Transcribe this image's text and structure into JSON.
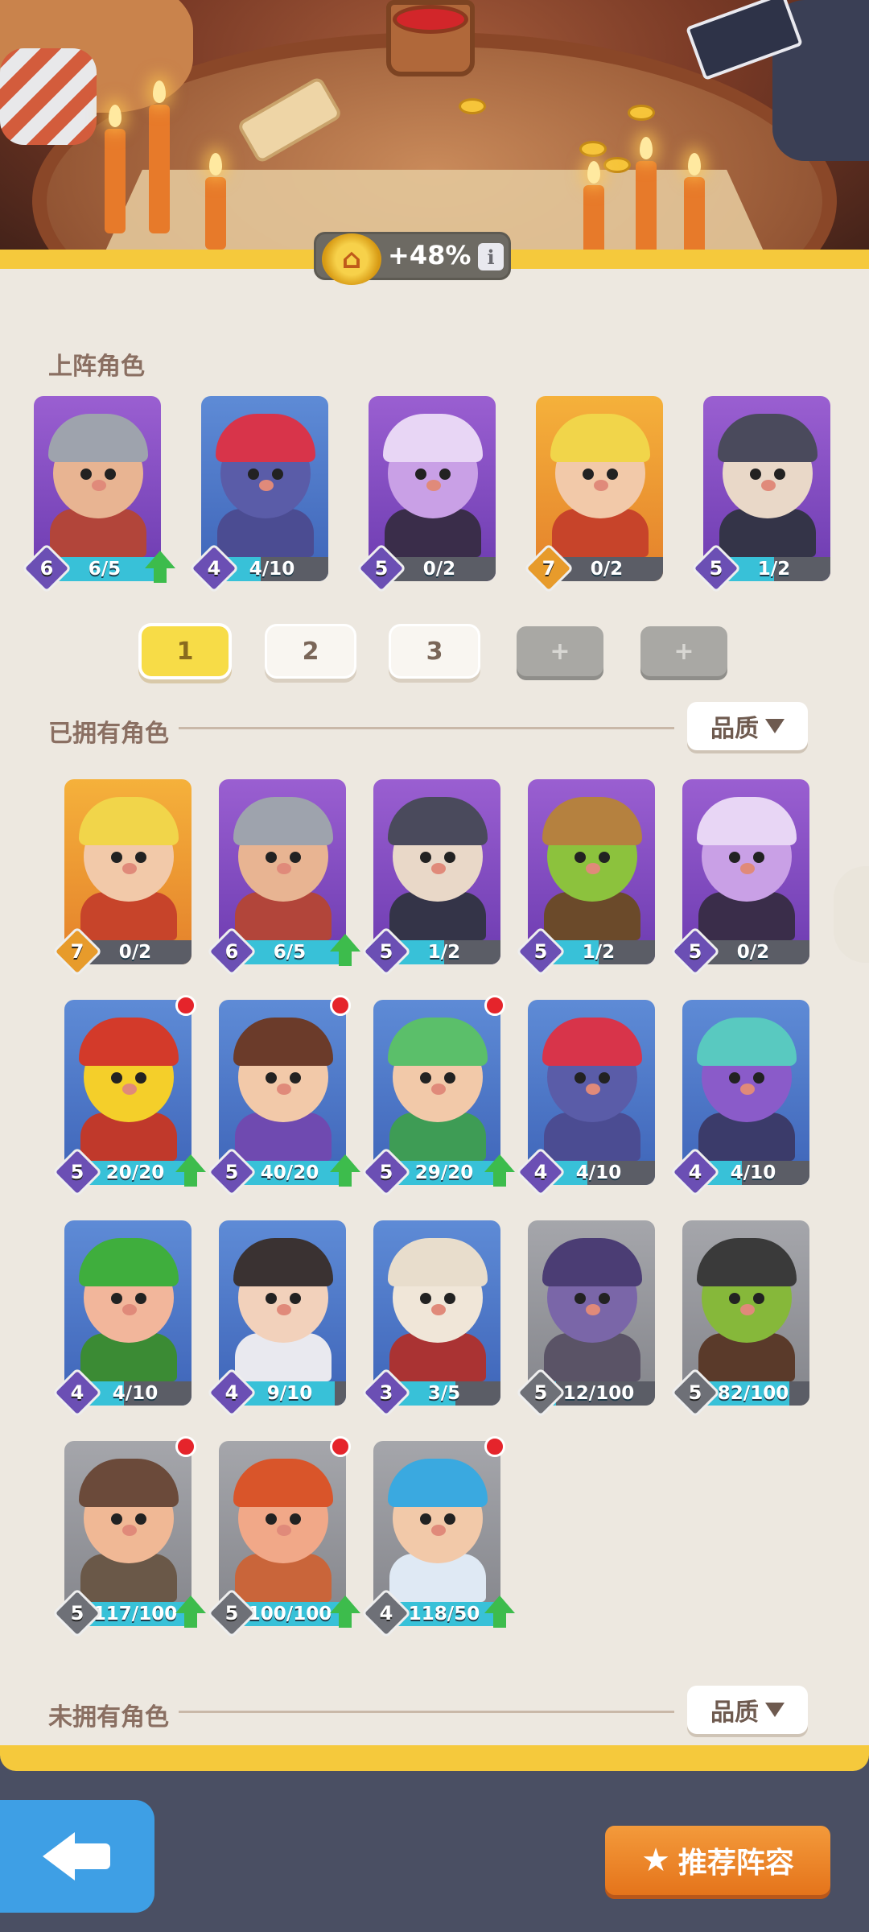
{
  "bonus": {
    "text": "+48%",
    "info_label": "i"
  },
  "sections": {
    "lineup_title": "上阵角色",
    "owned_title": "已拥有角色",
    "unowned_title": "未拥有角色"
  },
  "quality_button_label": "品质",
  "team_slots": [
    {
      "label": "1",
      "state": "active"
    },
    {
      "label": "2",
      "state": "normal"
    },
    {
      "label": "3",
      "state": "normal"
    },
    {
      "label": "+",
      "state": "locked"
    },
    {
      "label": "+",
      "state": "locked"
    }
  ],
  "lineup": [
    {
      "level": "6",
      "progress": "6/5",
      "ratio": 1.0,
      "rarity": "purple",
      "bg": "purple",
      "upgrade": true,
      "hero": "knight"
    },
    {
      "level": "4",
      "progress": "4/10",
      "ratio": 0.4,
      "rarity": "purple",
      "bg": "blue",
      "upgrade": false,
      "hero": "eye-mage"
    },
    {
      "level": "5",
      "progress": "0/2",
      "ratio": 0.0,
      "rarity": "purple",
      "bg": "purple",
      "upgrade": false,
      "hero": "demon-girl"
    },
    {
      "level": "7",
      "progress": "0/2",
      "ratio": 0.0,
      "rarity": "orange",
      "bg": "orange",
      "upgrade": false,
      "hero": "gunner"
    },
    {
      "level": "5",
      "progress": "1/2",
      "ratio": 0.5,
      "rarity": "purple",
      "bg": "purple",
      "upgrade": false,
      "hero": "dark-knight"
    }
  ],
  "owned": [
    {
      "level": "7",
      "progress": "0/2",
      "ratio": 0.0,
      "rarity": "orange",
      "bg": "orange",
      "upgrade": false,
      "dot": false,
      "hero": "gunner"
    },
    {
      "level": "6",
      "progress": "6/5",
      "ratio": 1.0,
      "rarity": "purple",
      "bg": "purple",
      "upgrade": true,
      "dot": false,
      "hero": "knight"
    },
    {
      "level": "5",
      "progress": "1/2",
      "ratio": 0.5,
      "rarity": "purple",
      "bg": "purple",
      "upgrade": false,
      "dot": false,
      "hero": "dark-knight"
    },
    {
      "level": "5",
      "progress": "1/2",
      "ratio": 0.5,
      "rarity": "purple",
      "bg": "purple",
      "upgrade": false,
      "dot": false,
      "hero": "goblin-engineer"
    },
    {
      "level": "5",
      "progress": "0/2",
      "ratio": 0.0,
      "rarity": "purple",
      "bg": "purple",
      "upgrade": false,
      "dot": false,
      "hero": "demon-girl"
    },
    {
      "level": "5",
      "progress": "20/20",
      "ratio": 1.0,
      "rarity": "purple",
      "bg": "blue",
      "upgrade": true,
      "dot": true,
      "hero": "bandit"
    },
    {
      "level": "5",
      "progress": "40/20",
      "ratio": 1.0,
      "rarity": "purple",
      "bg": "blue",
      "upgrade": true,
      "dot": true,
      "hero": "shield-boy"
    },
    {
      "level": "5",
      "progress": "29/20",
      "ratio": 1.0,
      "rarity": "purple",
      "bg": "blue",
      "upgrade": true,
      "dot": true,
      "hero": "elf-healer"
    },
    {
      "level": "4",
      "progress": "4/10",
      "ratio": 0.4,
      "rarity": "purple",
      "bg": "blue",
      "upgrade": false,
      "dot": false,
      "hero": "eye-mage"
    },
    {
      "level": "4",
      "progress": "4/10",
      "ratio": 0.4,
      "rarity": "purple",
      "bg": "blue",
      "upgrade": false,
      "dot": false,
      "hero": "imp"
    },
    {
      "level": "4",
      "progress": "4/10",
      "ratio": 0.4,
      "rarity": "purple",
      "bg": "blue",
      "upgrade": false,
      "dot": false,
      "hero": "druid"
    },
    {
      "level": "4",
      "progress": "9/10",
      "ratio": 0.9,
      "rarity": "purple",
      "bg": "blue",
      "upgrade": false,
      "dot": false,
      "hero": "cheerleader"
    },
    {
      "level": "3",
      "progress": "3/5",
      "ratio": 0.6,
      "rarity": "purple",
      "bg": "blue",
      "upgrade": false,
      "dot": false,
      "hero": "skeleton"
    },
    {
      "level": "5",
      "progress": "12/100",
      "ratio": 0.12,
      "rarity": "grey",
      "bg": "grey",
      "upgrade": false,
      "dot": false,
      "hero": "dark-elf"
    },
    {
      "level": "5",
      "progress": "82/100",
      "ratio": 0.82,
      "rarity": "grey",
      "bg": "grey",
      "upgrade": false,
      "dot": false,
      "hero": "goblin"
    },
    {
      "level": "5",
      "progress": "117/100",
      "ratio": 1.0,
      "rarity": "grey",
      "bg": "grey",
      "upgrade": true,
      "dot": true,
      "hero": "monk"
    },
    {
      "level": "5",
      "progress": "100/100",
      "ratio": 1.0,
      "rarity": "grey",
      "bg": "grey",
      "upgrade": true,
      "dot": true,
      "hero": "brawler"
    },
    {
      "level": "4",
      "progress": "118/50",
      "ratio": 1.0,
      "rarity": "grey",
      "bg": "grey",
      "upgrade": true,
      "dot": true,
      "hero": "ice-mage"
    }
  ],
  "bottom": {
    "recommend_label": "推荐阵容"
  },
  "colors": {
    "accent_yellow": "#f5c93c",
    "panel": "#ede8e0",
    "progress": "#38c1d8",
    "upgrade": "#3dbc4c",
    "back": "#3e9fe5",
    "recommend": "#e5741b"
  }
}
